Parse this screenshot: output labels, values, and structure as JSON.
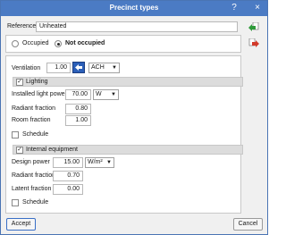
{
  "window": {
    "title": "Precinct types",
    "help_glyph": "?",
    "close_glyph": "×"
  },
  "reference": {
    "label": "Reference",
    "value": "Unheated"
  },
  "occupancy": {
    "occupied_label": "Occupied",
    "not_occupied_label": "Not occupied",
    "selected": "not_occupied"
  },
  "ventilation": {
    "label": "Ventilation",
    "value": "1.00",
    "unit": "ACH"
  },
  "lighting": {
    "header": "Lighting",
    "checked": true,
    "installed_power": {
      "label": "Installed light power",
      "value": "70.00",
      "unit": "W"
    },
    "radiant_fraction": {
      "label": "Radiant fraction",
      "value": "0.80"
    },
    "room_fraction": {
      "label": "Room fraction",
      "value": "1.00"
    },
    "schedule": {
      "label": "Schedule",
      "checked": false
    }
  },
  "equipment": {
    "header": "Internal equipment",
    "checked": true,
    "design_power": {
      "label": "Design power",
      "value": "15.00",
      "unit": "W/m²"
    },
    "radiant_fraction": {
      "label": "Radiant fraction",
      "value": "0.70"
    },
    "latent_fraction": {
      "label": "Latent fraction",
      "value": "0.00"
    },
    "schedule": {
      "label": "Schedule",
      "checked": false
    }
  },
  "buttons": {
    "accept": "Accept",
    "cancel": "Cancel"
  },
  "side_icons": [
    {
      "name": "import-icon",
      "color": "#2f9a3a"
    },
    {
      "name": "export-icon",
      "color": "#d23a2a"
    }
  ]
}
